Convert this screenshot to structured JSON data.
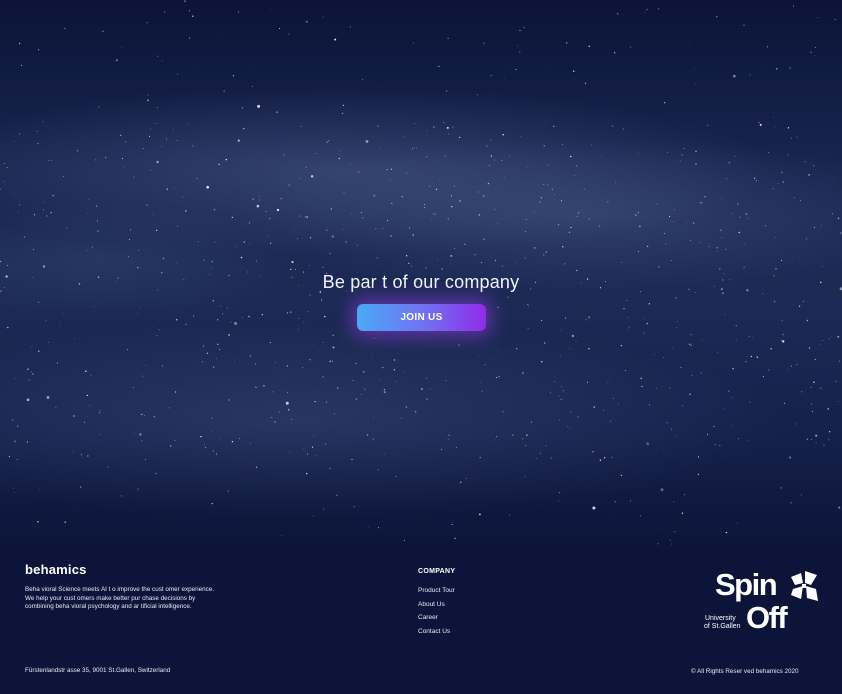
{
  "hero": {
    "title": "Be par  t of our company",
    "cta_label": "JOIN US"
  },
  "colors": {
    "background": "#0c1539",
    "button_gradient_start": "#4aa9f4",
    "button_gradient_end": "#8f2de8"
  },
  "footer": {
    "brand": {
      "logo_text": "behamics",
      "description": "Beha vioral Science meets AI t   o improve the cust omer experience. We help your cust   omers make better pur   chase decisions by combining beha   vioral psychology and ar   tificial intelligence."
    },
    "company": {
      "heading": "COMPANY",
      "links": [
        "Product Tour",
        "About Us",
        "Career",
        "Contact Us"
      ]
    },
    "spinoff": {
      "word1": "Spin",
      "word2": "Off",
      "uni_line1": "University",
      "uni_line2": "of St.Gallen",
      "icon": "spinoff-emblem-icon"
    },
    "address": "Fürstenlandstr  asse 35, 9001 St.Gallen, Switzerland",
    "copyright": "© All Rights Reser   ved behamics 2020"
  }
}
